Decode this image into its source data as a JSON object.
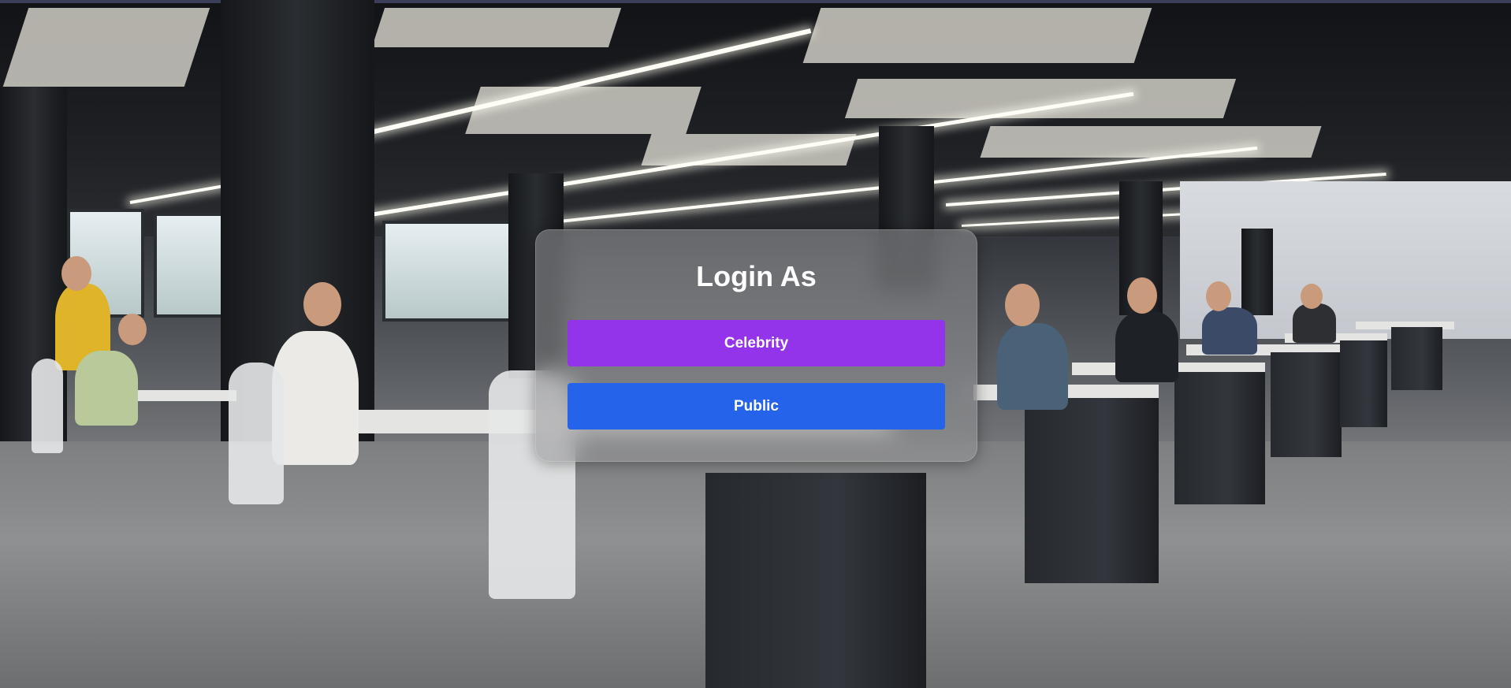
{
  "login": {
    "title": "Login As",
    "options": [
      {
        "label": "Celebrity",
        "color": "#9333ea"
      },
      {
        "label": "Public",
        "color": "#2563eb"
      }
    ]
  }
}
